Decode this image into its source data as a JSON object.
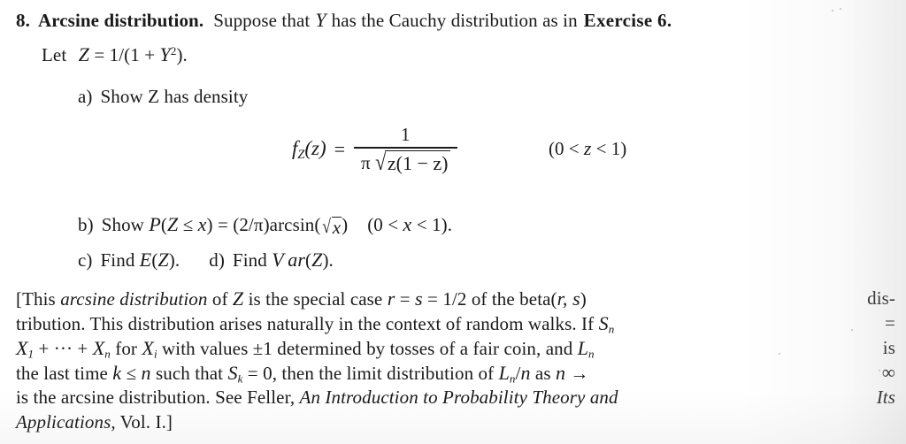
{
  "document": {
    "type": "scanned-textbook-exercise",
    "exercise_number": "8.",
    "exercise_title": "Arcsine distribution.",
    "page_background": "#ffffff",
    "ink_color": "#1a1a1a"
  },
  "heading": {
    "number": "8.",
    "title": "Arcsine distribution.",
    "statement_a": "Suppose that",
    "var_Y": "Y",
    "statement_b": "has the Cauchy distribution as in",
    "reference": "Exercise 6.",
    "let_prefix": "Let",
    "let_body": "Z = 1/(1 + Y²)."
  },
  "parts": {
    "a": {
      "label": "a)",
      "text": "Show Z has density",
      "formula": {
        "lhs": "f",
        "lhs_sub": "Z",
        "lhs_arg": "(z)",
        "equals": "=",
        "numerator": "1",
        "denominator_pi": "π",
        "denominator_radicand": "z(1 − z)",
        "range": "(0 < z < 1)"
      }
    },
    "b": {
      "label": "b)",
      "text_1": "Show P(Z ≤ x) = (2/π)arcsin(",
      "radicand": "x",
      "text_2": ")",
      "range": "(0 < x < 1)."
    },
    "c": {
      "label": "c)",
      "text": "Find E(Z)."
    },
    "d": {
      "label": "d)",
      "text": "Find Var(Z)."
    }
  },
  "note": {
    "lines": [
      {
        "left": "[This ",
        "italic_1": "arcsine distribution",
        "mid_1": " of Z is the special case r = s = 1/2 of the beta(r, s) ",
        "right": "dis-"
      },
      {
        "left": "tribution. This distribution arises naturally in the context of random walks. If S",
        "sub": "n",
        "right": " ="
      },
      {
        "left": "X₁ + ··· + X",
        "sub": "n",
        "mid": " for X",
        "sub2": "i",
        "mid2": " with values ±1 determined by tosses of a fair coin, and L",
        "sub3": "n",
        "right": " is"
      },
      {
        "left": "the last time k ≤ n such that S",
        "sub": "k",
        "mid": " = 0, then the limit distribution of L",
        "sub2": "n",
        "mid2": "/n as n → ",
        "right": "∞"
      },
      {
        "left": "is the arcsine distribution. See Feller, ",
        "italic_1": "An Introduction to Probability Theory and Its",
        "right": ""
      },
      {
        "italic_1": "Applications",
        "tail": ", Vol. I.]"
      }
    ]
  }
}
